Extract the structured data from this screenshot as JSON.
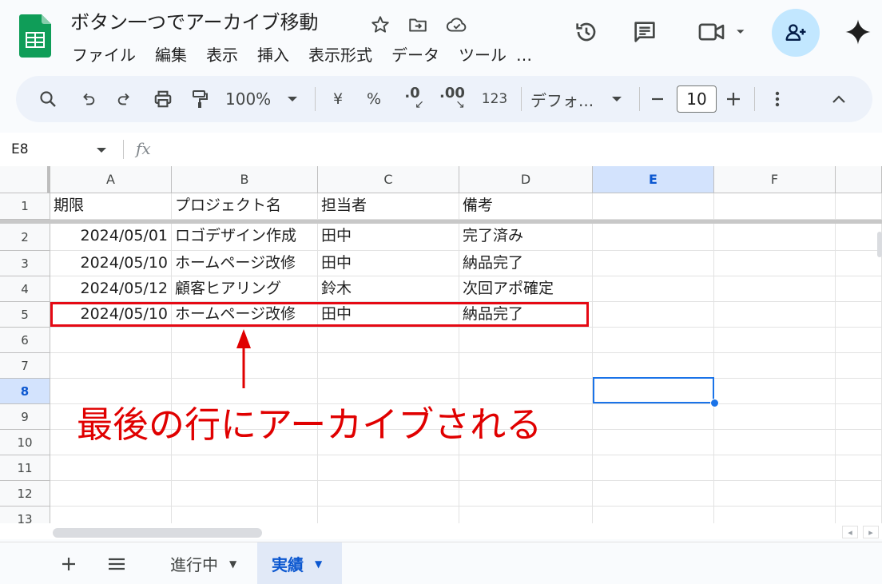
{
  "header": {
    "title": "ボタン一つでアーカイブ移動",
    "menus": [
      "ファイル",
      "編集",
      "表示",
      "挿入",
      "表示形式",
      "データ",
      "ツール",
      "…"
    ]
  },
  "toolbar": {
    "zoom": "100%",
    "currency": "¥",
    "percent": "%",
    "decrease_decimal": ".0",
    "increase_decimal": ".00",
    "number_format": "123",
    "font": "デフォ...",
    "font_size": "10"
  },
  "formula_bar": {
    "name_box": "E8",
    "fx": "fx"
  },
  "columns": [
    "A",
    "B",
    "C",
    "D",
    "E",
    "F"
  ],
  "active_column": "E",
  "rows": [
    "1",
    "2",
    "3",
    "4",
    "5",
    "6",
    "7",
    "8",
    "9",
    "10",
    "11",
    "12",
    "13"
  ],
  "active_row": "8",
  "table": {
    "header": [
      "期限",
      "プロジェクト名",
      "担当者",
      "備考"
    ],
    "data": [
      [
        "2024/05/01",
        "ロゴデザイン作成",
        "田中",
        "完了済み"
      ],
      [
        "2024/05/10",
        "ホームページ改修",
        "田中",
        "納品完了"
      ],
      [
        "2024/05/12",
        "顧客ヒアリング",
        "鈴木",
        "次回アポ確定"
      ],
      [
        "2024/05/10",
        "ホームページ改修",
        "田中",
        "納品完了"
      ]
    ]
  },
  "annotation": {
    "text": "最後の行にアーカイブされる",
    "color": "#e00000"
  },
  "sheets": {
    "tabs": [
      "進行中",
      "実績"
    ],
    "active": "実績"
  },
  "colors": {
    "accent": "#0b57d0",
    "selection": "#1a73e8",
    "highlight": "#e50914"
  }
}
